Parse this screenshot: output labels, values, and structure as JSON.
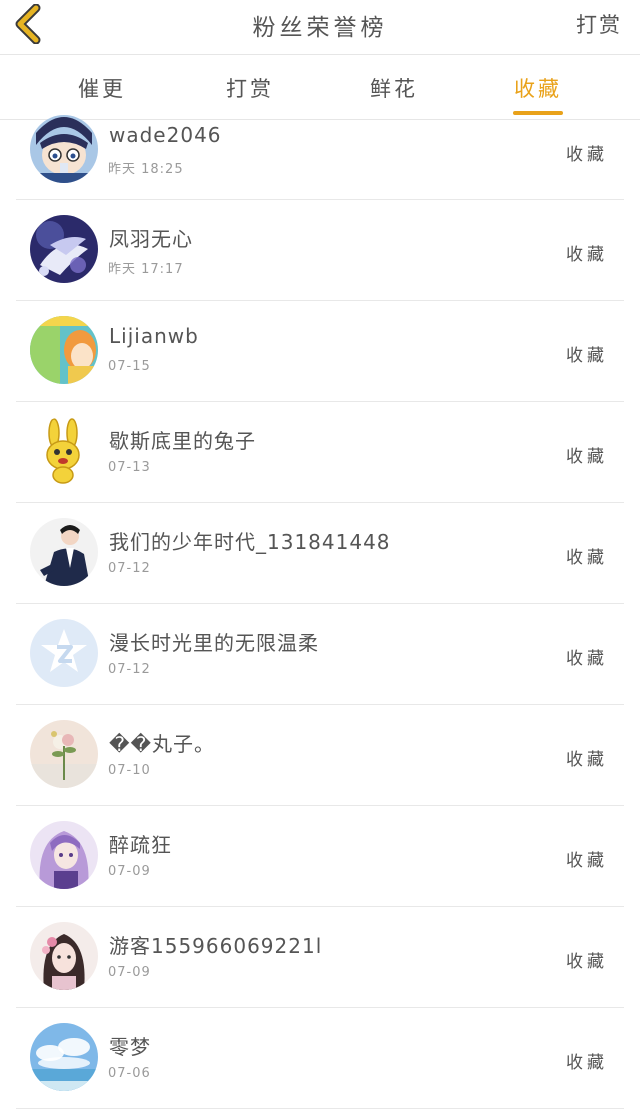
{
  "header": {
    "title": "粉丝荣誉榜",
    "action_label": "打赏"
  },
  "tabs": [
    {
      "label": "催更",
      "active": false
    },
    {
      "label": "打赏",
      "active": false
    },
    {
      "label": "鲜花",
      "active": false
    },
    {
      "label": "收藏",
      "active": true
    }
  ],
  "colors": {
    "accent": "#e9a21a",
    "back_arrow": "#e6b423"
  },
  "fans": [
    {
      "name": "wade2046",
      "time": "昨天 18:25",
      "action": "收藏",
      "avatar": "anime-boy-avatar"
    },
    {
      "name": "凤羽无心",
      "time": "昨天 17:17",
      "action": "收藏",
      "avatar": "purple-fantasy-avatar"
    },
    {
      "name": "Lijianwb",
      "time": "07-15",
      "action": "收藏",
      "avatar": "cartoon-girl-avatar"
    },
    {
      "name": "歇斯底里的兔子",
      "time": "07-13",
      "action": "收藏",
      "avatar": "yellow-rabbit-avatar"
    },
    {
      "name": "我们的少年时代_131841448",
      "time": "07-12",
      "action": "收藏",
      "avatar": "suit-man-avatar"
    },
    {
      "name": "漫长时光里的无限温柔",
      "time": "07-12",
      "action": "收藏",
      "avatar": "default-star-avatar"
    },
    {
      "name": "��丸子。",
      "time": "07-10",
      "action": "收藏",
      "avatar": "flower-avatar"
    },
    {
      "name": "醉疏狂",
      "time": "07-09",
      "action": "收藏",
      "avatar": "purple-hair-avatar"
    },
    {
      "name": "游客155966069221l",
      "time": "07-09",
      "action": "收藏",
      "avatar": "ancient-girl-avatar"
    },
    {
      "name": "零梦",
      "time": "07-06",
      "action": "收藏",
      "avatar": "sky-clouds-avatar"
    }
  ]
}
